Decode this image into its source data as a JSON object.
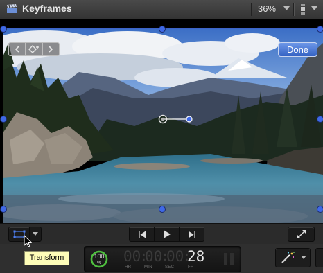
{
  "window": {
    "title": "Keyframes",
    "zoom": "36%"
  },
  "viewer": {
    "done_label": "Done",
    "frame_color": "#3d63c8",
    "handle_color": "#3f69e6"
  },
  "controls": {
    "transform_tooltip": "Transform",
    "accent": "#3f69e6"
  },
  "timecode": {
    "progress_percent": 100,
    "progress_value": "100",
    "progress_unit": "%",
    "hours": "00",
    "minutes": "00",
    "seconds": "00",
    "frames": "28",
    "labels": {
      "hr": "HR",
      "min": "MIN",
      "sec": "SEC",
      "fr": "FR"
    }
  },
  "icons": [
    "clapperboard-icon",
    "chevron-down-icon",
    "viewer-options-icon",
    "previous-keyframe-icon",
    "add-keyframe-icon",
    "next-keyframe-icon",
    "transform-icon",
    "go-to-start-icon",
    "play-icon",
    "go-to-end-icon",
    "fullscreen-icon",
    "pause-icon",
    "magic-wand-icon",
    "mouse-pointer-icon"
  ]
}
